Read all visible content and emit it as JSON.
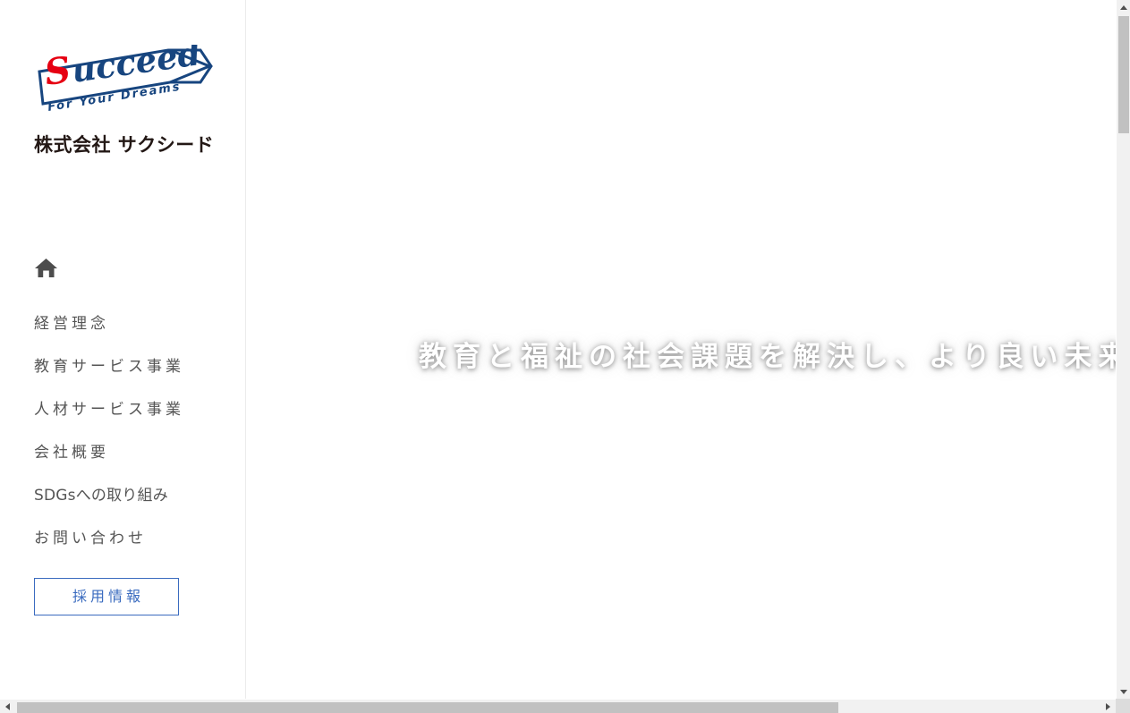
{
  "sidebar": {
    "logo": {
      "brand_word": "Succeed",
      "tagline": "For Your Dreams",
      "company_name": "株式会社 サクシード",
      "brand_initial": "S",
      "brand_red": "#e60012",
      "brand_navy": "#17457f",
      "company_name_color": "#231815"
    },
    "home_icon": "home-icon",
    "nav_items": [
      {
        "label": "経営理念",
        "tight": false
      },
      {
        "label": "教育サービス事業",
        "tight": false
      },
      {
        "label": "人材サービス事業",
        "tight": false
      },
      {
        "label": "会社概要",
        "tight": false
      },
      {
        "label": "SDGsへの取り組み",
        "tight": true
      },
      {
        "label": "お問い合わせ",
        "tight": false
      }
    ],
    "recruit_button": {
      "label": "採用情報",
      "border_color": "#3a6bbf",
      "text_color": "#3a6bbf"
    }
  },
  "hero": {
    "headline": "教育と福祉の社会課題を解決し、より良い未来を創造",
    "text_color": "#ffffff",
    "background_color": "#ffffff"
  },
  "scrollbars": {
    "vertical": {
      "up_arrow_icon": "triangle-up-icon",
      "down_arrow_icon": "triangle-down-icon",
      "thumb_color": "#c1c1c1",
      "track_color": "#f1f1f1"
    },
    "horizontal": {
      "left_arrow_icon": "triangle-left-icon",
      "right_arrow_icon": "triangle-right-icon",
      "thumb_color": "#c1c1c1",
      "track_color": "#f1f1f1"
    },
    "corner_color": "#dcdcdc"
  }
}
